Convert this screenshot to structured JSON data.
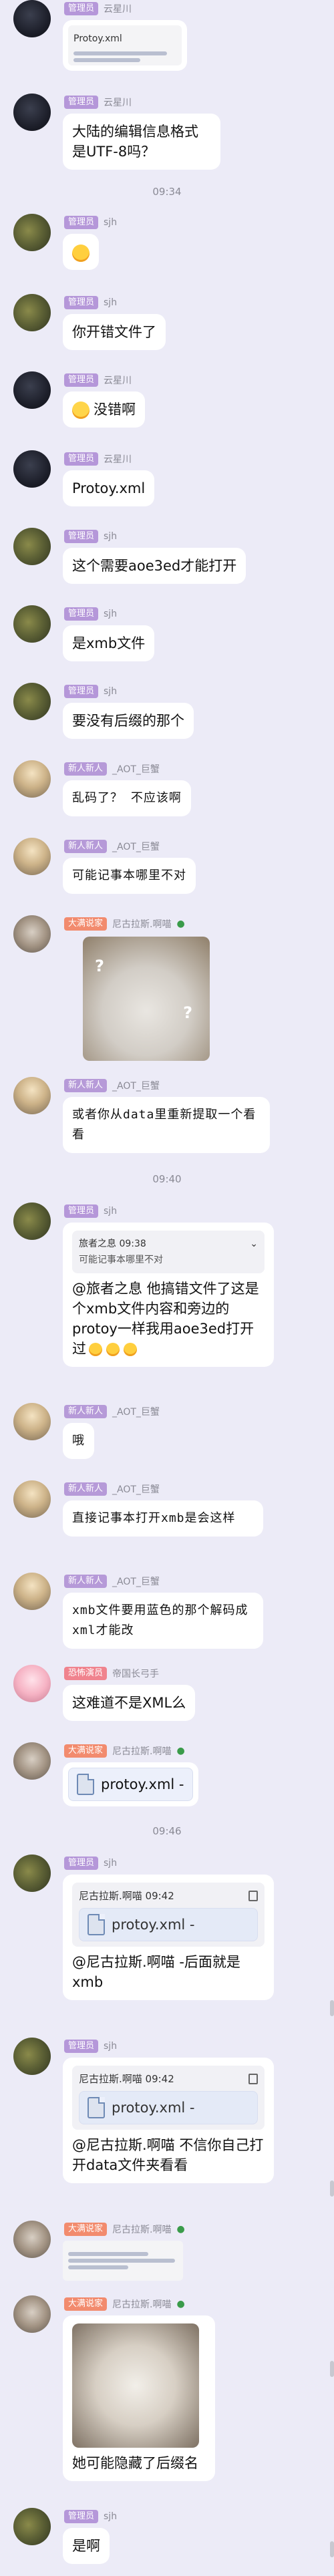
{
  "colors": {
    "background": "#ecebf7",
    "badge_admin": "#b597d9",
    "badge_new": "#b69ad8",
    "badge_big": "#f28b6e",
    "badge_prop": "#f0838e"
  },
  "times": [
    "09:34",
    "09:40",
    "09:46"
  ],
  "messages": [
    {
      "badge": "管理员",
      "nick": "云星川",
      "text": "Protoy.xml"
    },
    {
      "badge": "管理员",
      "nick": "云星川",
      "text": "大陆的编辑信息格式是UTF-8吗？"
    },
    {
      "badge": "管理员",
      "nick": "sjh",
      "text": ""
    },
    {
      "badge": "管理员",
      "nick": "sjh",
      "text": "你开错文件了"
    },
    {
      "badge": "管理员",
      "nick": "云星川",
      "text": "没错啊"
    },
    {
      "badge": "管理员",
      "nick": "云星川",
      "text": "Protoy.xml"
    },
    {
      "badge": "管理员",
      "nick": "sjh",
      "text": "这个需要aoe3ed才能打开"
    },
    {
      "badge": "管理员",
      "nick": "sjh",
      "text": "是xmb文件"
    },
    {
      "badge": "管理员",
      "nick": "sjh",
      "text": "要没有后缀的那个"
    },
    {
      "badge": "新人新人",
      "nick": "_AOT_巨蟹",
      "text": "乱码了？ 不应该啊"
    },
    {
      "badge": "新人新人",
      "nick": "_AOT_巨蟹",
      "text": "可能记事本哪里不对"
    },
    {
      "badge": "大满说家",
      "nick": "尼古拉斯.啊喵",
      "text": ""
    },
    {
      "badge": "新人新人",
      "nick": "_AOT_巨蟹",
      "text": "或者你从data里重新提取一个看看"
    },
    {
      "badge": "管理员",
      "nick": "sjh",
      "text": "@旅者之息 他搞错文件了这是个xmb文件内容和旁边的protoy一样我用aoe3ed打开过",
      "quote_head": "旅者之息 09:38",
      "quote_sub": "可能记事本哪里不对"
    },
    {
      "badge": "新人新人",
      "nick": "_AOT_巨蟹",
      "text": "哦"
    },
    {
      "badge": "新人新人",
      "nick": "_AOT_巨蟹",
      "text": "直接记事本打开xmb是会这样"
    },
    {
      "badge": "新人新人",
      "nick": "_AOT_巨蟹",
      "text": "xmb文件要用蓝色的那个解码成xml才能改"
    },
    {
      "badge": "恐怖演员",
      "nick": "帝国长弓手",
      "text": "这难道不是XML么"
    },
    {
      "badge": "大满说家",
      "nick": "尼古拉斯.啊喵",
      "text": "protoy.xml -"
    },
    {
      "badge": "管理员",
      "nick": "sjh",
      "text": "@尼古拉斯.啊喵 -后面就是xmb",
      "fwd_head": "尼古拉斯.啊喵 09:42",
      "file": "protoy.xml -"
    },
    {
      "badge": "管理员",
      "nick": "sjh",
      "text": "@尼古拉斯.啊喵 不信你自己打开data文件夹看看",
      "fwd_head": "尼古拉斯.啊喵 09:42",
      "file": "protoy.xml -"
    },
    {
      "badge": "大满说家",
      "nick": "尼古拉斯.啊喵",
      "text": ""
    },
    {
      "badge": "大满说家",
      "nick": "尼古拉斯.啊喵",
      "text": "她可能隐藏了后缀名"
    },
    {
      "badge": "管理员",
      "nick": "sjh",
      "text": "是啊"
    }
  ]
}
